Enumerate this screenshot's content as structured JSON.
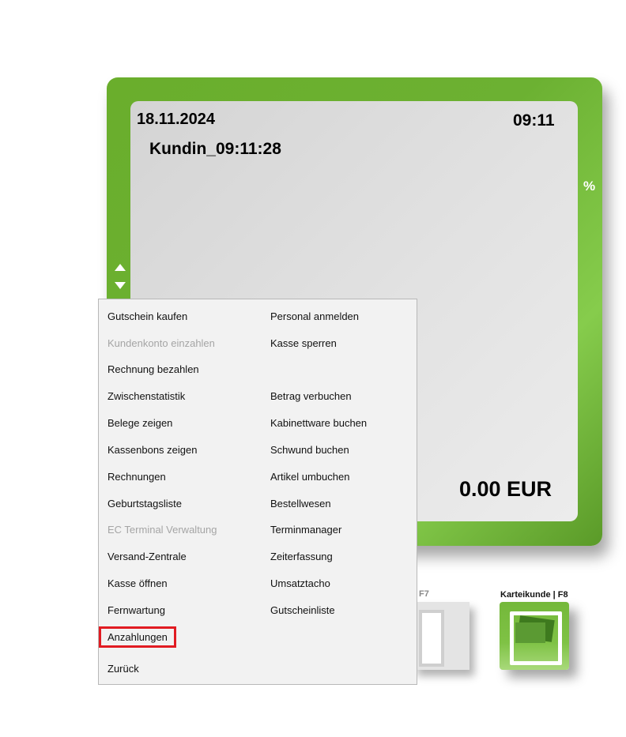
{
  "register": {
    "date": "18.11.2024",
    "time": "09:11",
    "customer": "Kundin_09:11:28",
    "total": "0.00 EUR",
    "percent_label": "%"
  },
  "buttons": {
    "f7_label": "F7",
    "f8_label": "Karteikunde | F8"
  },
  "menu": {
    "left": [
      {
        "label": "Gutschein kaufen",
        "enabled": true
      },
      {
        "label": "Kundenkonto einzahlen",
        "enabled": false
      },
      {
        "label": "Rechnung bezahlen",
        "enabled": true
      },
      {
        "label": "Zwischenstatistik",
        "enabled": true
      },
      {
        "label": "Belege zeigen",
        "enabled": true
      },
      {
        "label": "Kassenbons zeigen",
        "enabled": true
      },
      {
        "label": "Rechnungen",
        "enabled": true
      },
      {
        "label": "Geburtstagsliste",
        "enabled": true
      },
      {
        "label": "EC Terminal Verwaltung",
        "enabled": false
      },
      {
        "label": "Versand-Zentrale",
        "enabled": true
      },
      {
        "label": "Kasse öffnen",
        "enabled": true
      },
      {
        "label": "Fernwartung",
        "enabled": true
      },
      {
        "label": "Anzahlungen",
        "enabled": true,
        "highlighted": true
      },
      {
        "label": "Zurück",
        "enabled": true
      }
    ],
    "right": [
      {
        "label": "Personal anmelden",
        "enabled": true
      },
      {
        "label": "Kasse sperren",
        "enabled": true
      },
      {
        "label": "Betrag verbuchen",
        "enabled": true
      },
      {
        "label": "Kabinettware buchen",
        "enabled": true
      },
      {
        "label": "Schwund buchen",
        "enabled": true
      },
      {
        "label": "Artikel umbuchen",
        "enabled": true
      },
      {
        "label": "Bestellwesen",
        "enabled": true
      },
      {
        "label": "Terminmanager",
        "enabled": true
      },
      {
        "label": "Zeiterfassung",
        "enabled": true
      },
      {
        "label": "Umsatztacho",
        "enabled": true
      },
      {
        "label": "Gutscheinliste",
        "enabled": true
      }
    ]
  },
  "colors": {
    "frame_green": "#6cb132",
    "highlight_red": "#e11b22",
    "disabled_text": "#a5a5a5"
  }
}
